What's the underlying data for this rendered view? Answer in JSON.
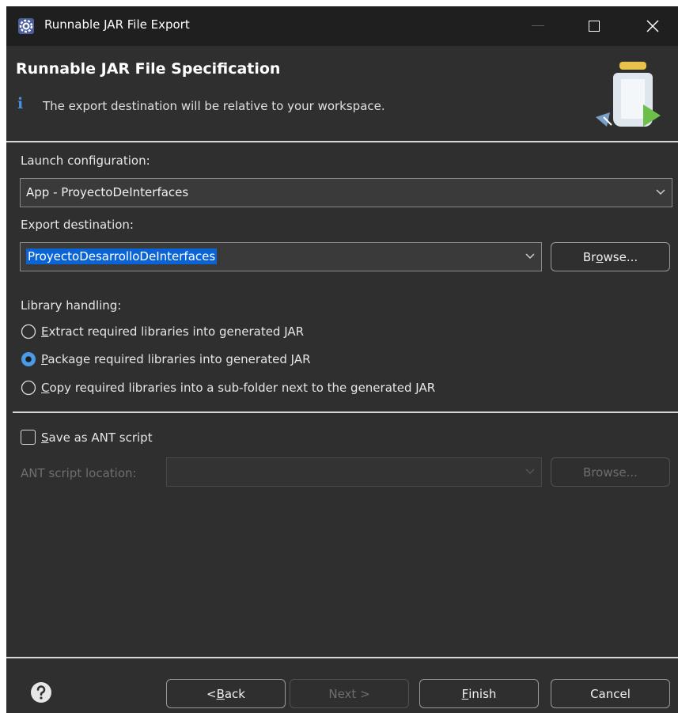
{
  "window": {
    "title": "Runnable JAR File Export",
    "icon": "eclipse-gear-icon"
  },
  "banner": {
    "title": "Runnable JAR File Specification",
    "message": "The export destination will be relative to your workspace.",
    "info_icon": "i"
  },
  "launch": {
    "label": "Launch configuration:",
    "value": "App - ProyectoDeInterfaces"
  },
  "export": {
    "label": "Export destination:",
    "value": "ProyectoDesarrolloDeInterfaces",
    "browse_pre": "Br",
    "browse_key": "o",
    "browse_post": "wse..."
  },
  "library": {
    "label": "Library handling:",
    "options": [
      {
        "key": "E",
        "rest": "xtract required libraries into generated JAR",
        "selected": false
      },
      {
        "key": "P",
        "rest": "ackage required libraries into generated JAR",
        "selected": true
      },
      {
        "key": "C",
        "rest": "opy required libraries into a sub-folder next to the generated JAR",
        "selected": false
      }
    ]
  },
  "ant": {
    "checkbox_key": "S",
    "checkbox_rest": "ave as ANT script",
    "checked": false,
    "location_label": "ANT script location:",
    "location_value": "",
    "browse_label": "Browse..."
  },
  "footer": {
    "back_pre": "< ",
    "back_key": "B",
    "back_post": "ack",
    "next_label": "Next >",
    "finish_key": "F",
    "finish_rest": "inish",
    "cancel_label": "Cancel"
  },
  "colors": {
    "background": "#2f2f2f",
    "titlebar": "#1f1f1f",
    "selection": "#0a64d6",
    "radio_selected": "#4a9ae8"
  }
}
